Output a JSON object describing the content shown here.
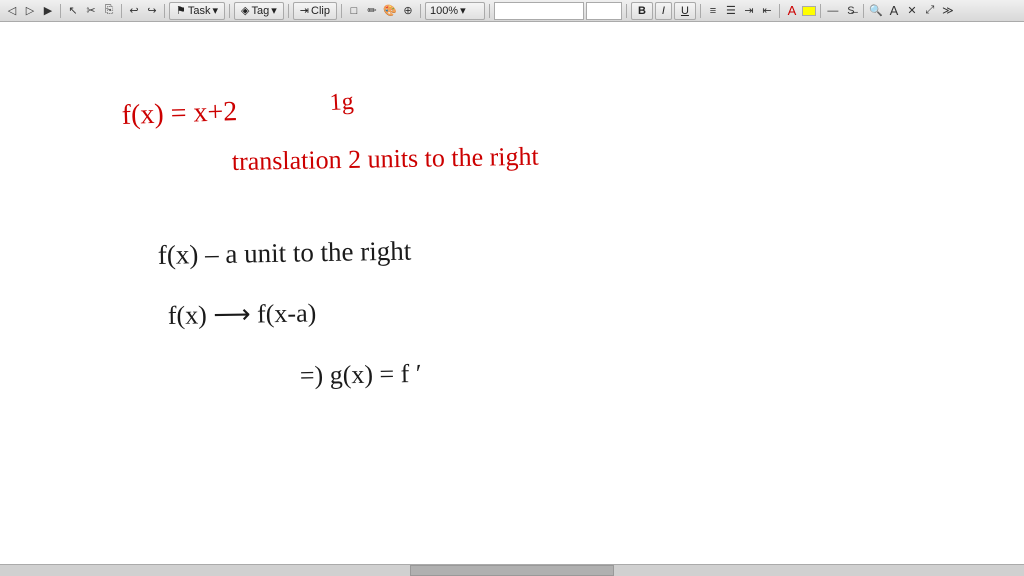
{
  "toolbar": {
    "task_label": "Task",
    "tag_label": "Tag",
    "clip_label": "Clip",
    "zoom_label": "100%",
    "bold_label": "B",
    "italic_label": "I",
    "underline_label": "U",
    "font_input_placeholder": "",
    "font_size_placeholder": ""
  },
  "content": {
    "line1_red": "f(x) = x+2",
    "line1b_red": "1g",
    "line2_red": "translation 2 units to the right",
    "line3_black": "f(x)    - a unit to the right",
    "line4_black": "f(x) → f(x-a)",
    "line5_black": "=) g(x) = f'"
  }
}
